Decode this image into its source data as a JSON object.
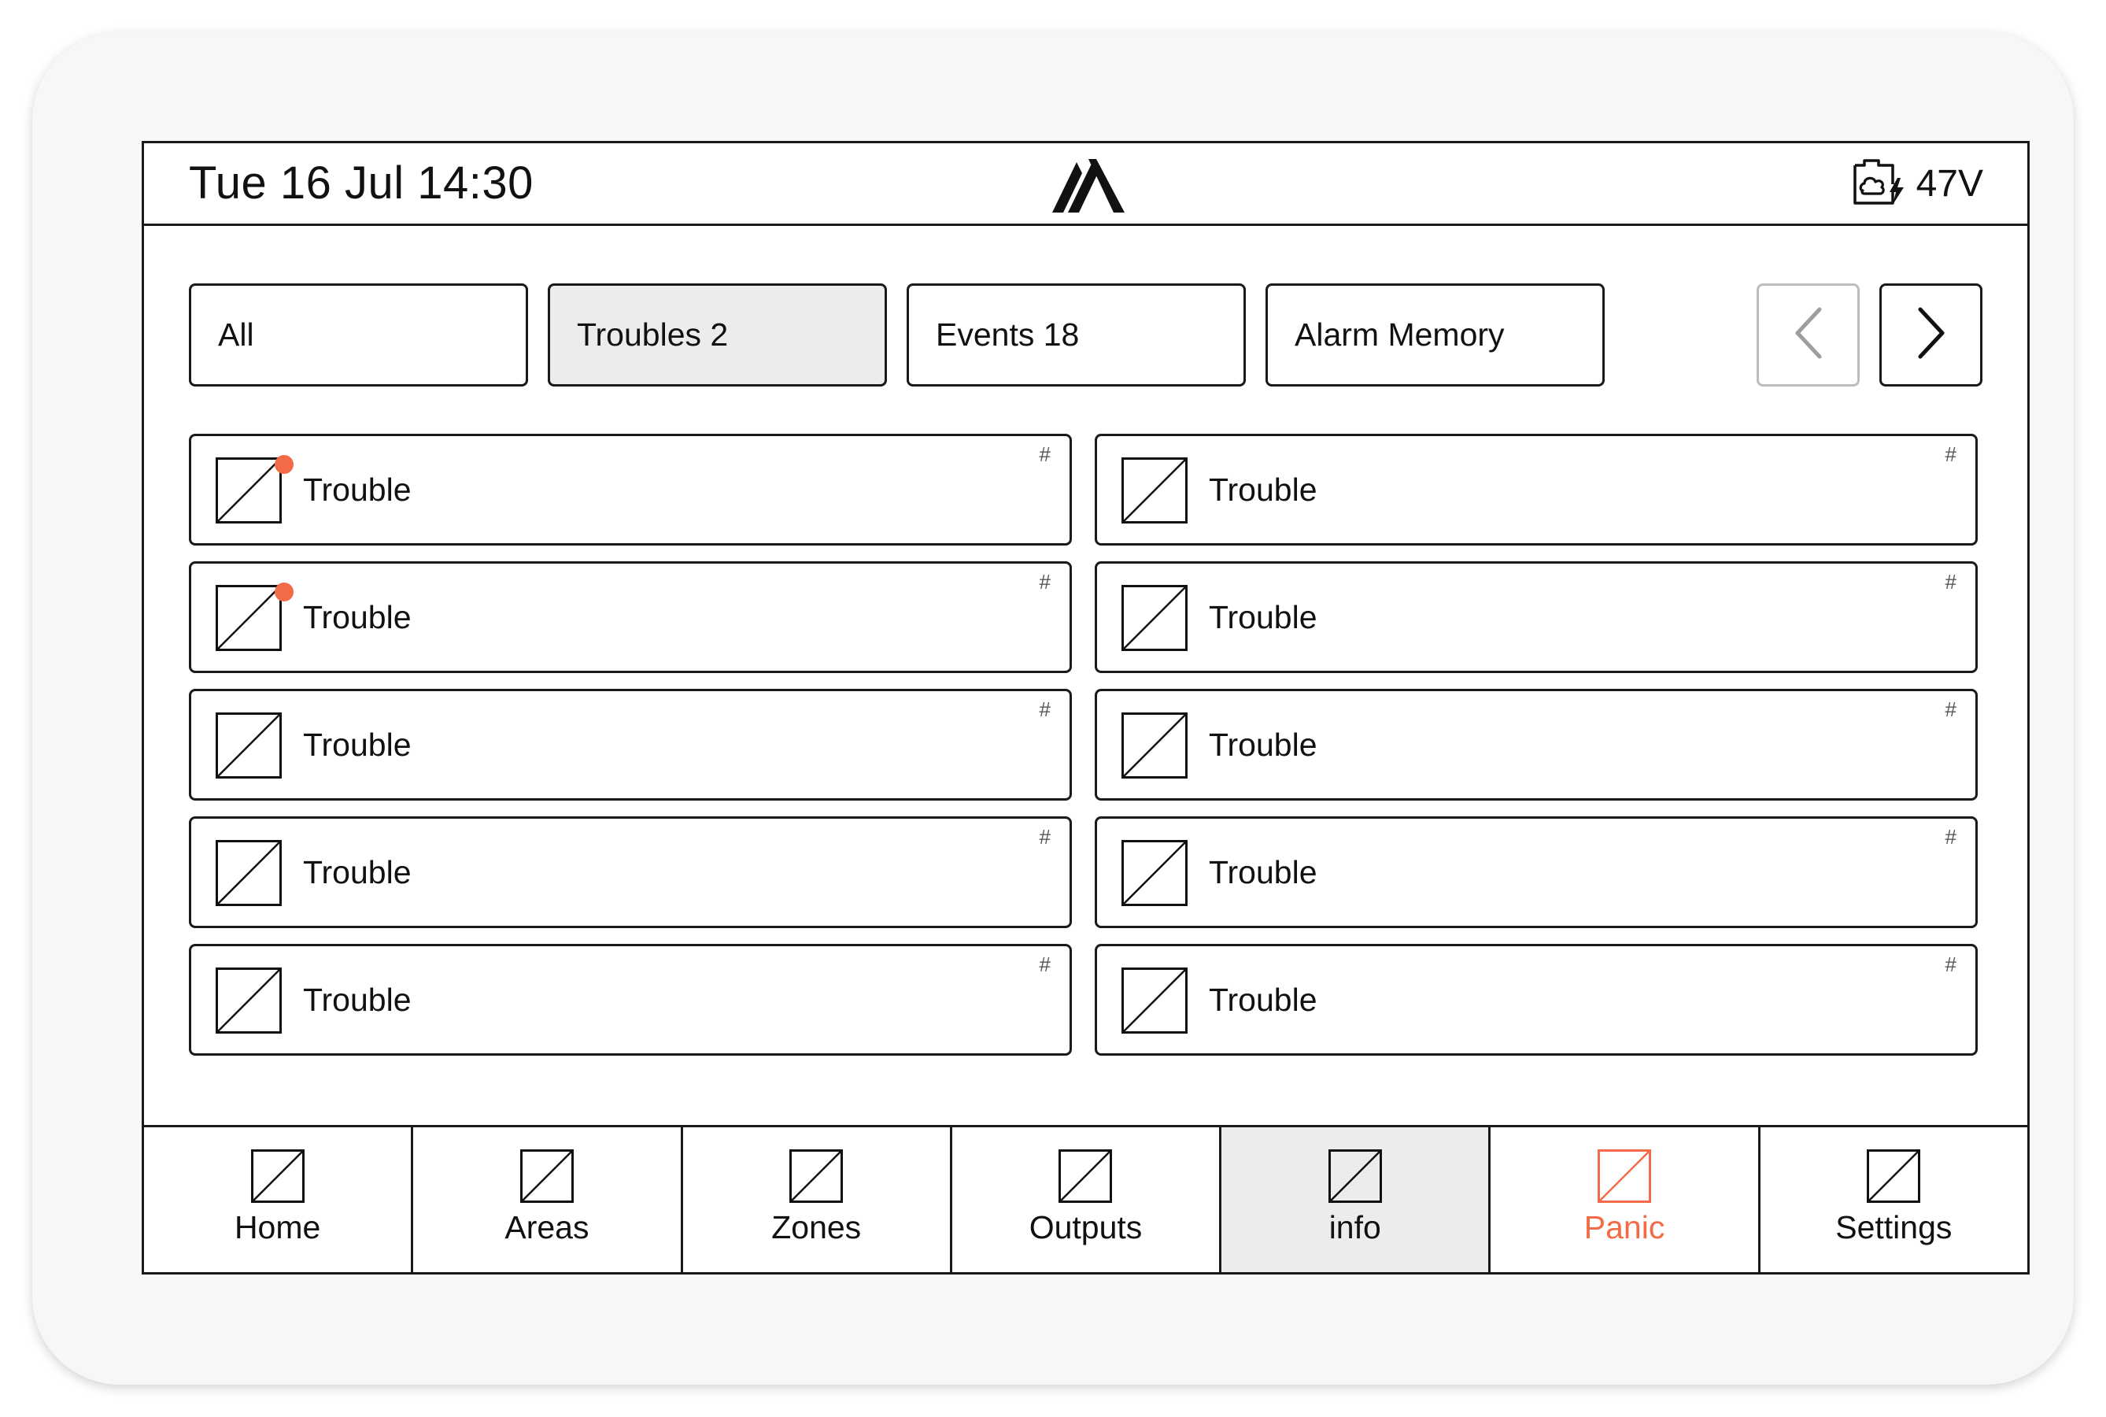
{
  "header": {
    "datetime": "Tue 16 Jul 14:30",
    "power_value": "47V",
    "logo_icon": "brand-logo-icon",
    "power_icon": "power-supply-icon"
  },
  "tabs": [
    {
      "label": "All",
      "active": false
    },
    {
      "label": "Troubles 2",
      "active": true
    },
    {
      "label": "Events 18",
      "active": false
    },
    {
      "label": "Alarm Memory",
      "active": false
    }
  ],
  "pager": {
    "prev_icon": "chevron-left-icon",
    "next_icon": "chevron-right-icon",
    "prev_enabled": false,
    "next_enabled": true
  },
  "items": [
    {
      "label": "Trouble",
      "hash": "#",
      "unread": true
    },
    {
      "label": "Trouble",
      "hash": "#",
      "unread": false
    },
    {
      "label": "Trouble",
      "hash": "#",
      "unread": true
    },
    {
      "label": "Trouble",
      "hash": "#",
      "unread": false
    },
    {
      "label": "Trouble",
      "hash": "#",
      "unread": false
    },
    {
      "label": "Trouble",
      "hash": "#",
      "unread": false
    },
    {
      "label": "Trouble",
      "hash": "#",
      "unread": false
    },
    {
      "label": "Trouble",
      "hash": "#",
      "unread": false
    },
    {
      "label": "Trouble",
      "hash": "#",
      "unread": false
    },
    {
      "label": "Trouble",
      "hash": "#",
      "unread": false
    }
  ],
  "bottom_nav": [
    {
      "label": "Home",
      "selected": false
    },
    {
      "label": "Areas",
      "selected": false
    },
    {
      "label": "Zones",
      "selected": false
    },
    {
      "label": "Outputs",
      "selected": false
    },
    {
      "label": "info",
      "selected": true
    },
    {
      "label": "Panic",
      "selected": false
    },
    {
      "label": "Settings",
      "selected": false
    }
  ],
  "colors": {
    "accent": "#f36b46",
    "border": "#1a1a1a",
    "selected_bg": "#ececec",
    "disabled_border": "#bdbdbd"
  }
}
